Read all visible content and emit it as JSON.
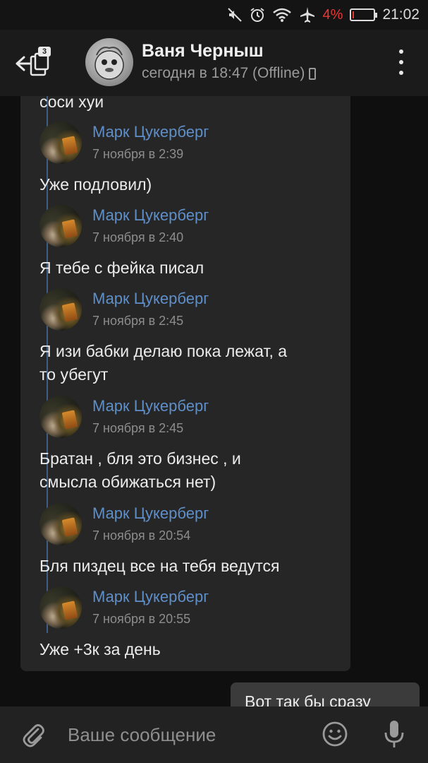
{
  "statusbar": {
    "battery_percent": "4%",
    "battery_level": 0.04,
    "time": "21:02",
    "icons": [
      "mute-icon",
      "alarm-icon",
      "wifi-icon",
      "airplane-icon",
      "battery-icon"
    ]
  },
  "header": {
    "unread_count": "3",
    "contact_name": "Ваня Черныш",
    "contact_status": "сегодня в 18:47 (Offline)",
    "icons": [
      "back-arrow-icon",
      "more-vert-icon",
      "phone-icon"
    ]
  },
  "forwarded": {
    "top_text": "соси хуи",
    "messages": [
      {
        "author": "Марк Цукерберг",
        "date": "7 ноября в 2:39",
        "text": "Уже подловил)"
      },
      {
        "author": "Марк Цукерберг",
        "date": "7 ноября в 2:40",
        "text": "Я тебе с фейка писал"
      },
      {
        "author": "Марк Цукерберг",
        "date": "7 ноября в 2:45",
        "text_lines": [
          "Я изи бабки делаю пока лежат, а",
          "то убегут"
        ]
      },
      {
        "author": "Марк Цукерберг",
        "date": "7 ноября в 2:45",
        "text_lines": [
          "Братан , бля это бизнес , и",
          "смысла обижаться нет)"
        ]
      },
      {
        "author": "Марк Цукерберг",
        "date": "7 ноября в 20:54",
        "text": "Бля пиздец все на тебя ведутся"
      },
      {
        "author": "Марк Цукерберг",
        "date": "7 ноября в 20:55",
        "text": "Уже +3к за день"
      }
    ]
  },
  "own_message": {
    "text": "Вот так бы сразу"
  },
  "composer": {
    "placeholder": "Ваше сообщение",
    "icons": [
      "paperclip-icon",
      "emoji-icon",
      "microphone-icon"
    ]
  },
  "colors": {
    "accent_link": "#5f8fc9",
    "forward_line": "#3f5e82",
    "battery_low": "#e53935"
  }
}
